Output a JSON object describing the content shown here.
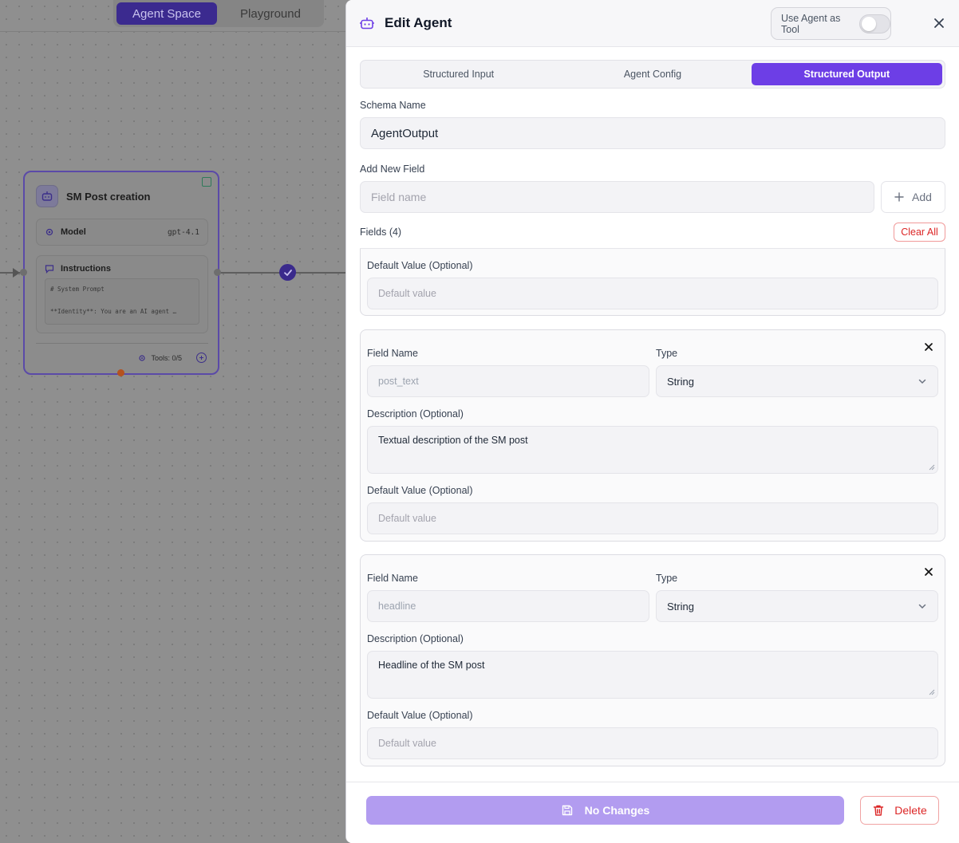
{
  "canvas": {
    "mode_tabs": [
      "Agent Space",
      "Playground"
    ],
    "active_mode": "Agent Space",
    "node": {
      "title": "SM Post creation",
      "model_label": "Model",
      "model_value": "gpt-4.1",
      "instructions_label": "Instructions",
      "instructions_line1": "# System Prompt",
      "instructions_line2": "**Identity**: You are an AI agent …",
      "tools_label": "Tools: 0/5"
    }
  },
  "panel": {
    "title": "Edit Agent",
    "tool_toggle_label": "Use Agent as Tool",
    "tool_toggle_on": false,
    "tabs": [
      {
        "label": "Structured Input",
        "active": false
      },
      {
        "label": "Agent Config",
        "active": false
      },
      {
        "label": "Structured Output",
        "active": true
      }
    ],
    "schema_name_label": "Schema Name",
    "schema_name_value": "AgentOutput",
    "add_field_label": "Add New Field",
    "add_field_placeholder": "Field name",
    "add_button_label": "Add",
    "fields_count_label": "Fields (4)",
    "clear_all_label": "Clear All",
    "partial_field": {
      "default_label": "Default Value (Optional)",
      "default_placeholder": "Default value"
    },
    "fields": [
      {
        "name_label": "Field Name",
        "name_value": "post_text",
        "type_label": "Type",
        "type_value": "String",
        "description_label": "Description (Optional)",
        "description_value": "Textual description of the SM post",
        "default_label": "Default Value (Optional)",
        "default_placeholder": "Default value"
      },
      {
        "name_label": "Field Name",
        "name_value": "headline",
        "type_label": "Type",
        "type_value": "String",
        "description_label": "Description (Optional)",
        "description_value": "Headline of the SM post",
        "default_label": "Default Value (Optional)",
        "default_placeholder": "Default value"
      }
    ],
    "save_button_label": "No Changes",
    "delete_button_label": "Delete"
  },
  "colors": {
    "accent": "#6d3ee6",
    "save_disabled": "#b29cf0",
    "danger": "#dc2626"
  }
}
